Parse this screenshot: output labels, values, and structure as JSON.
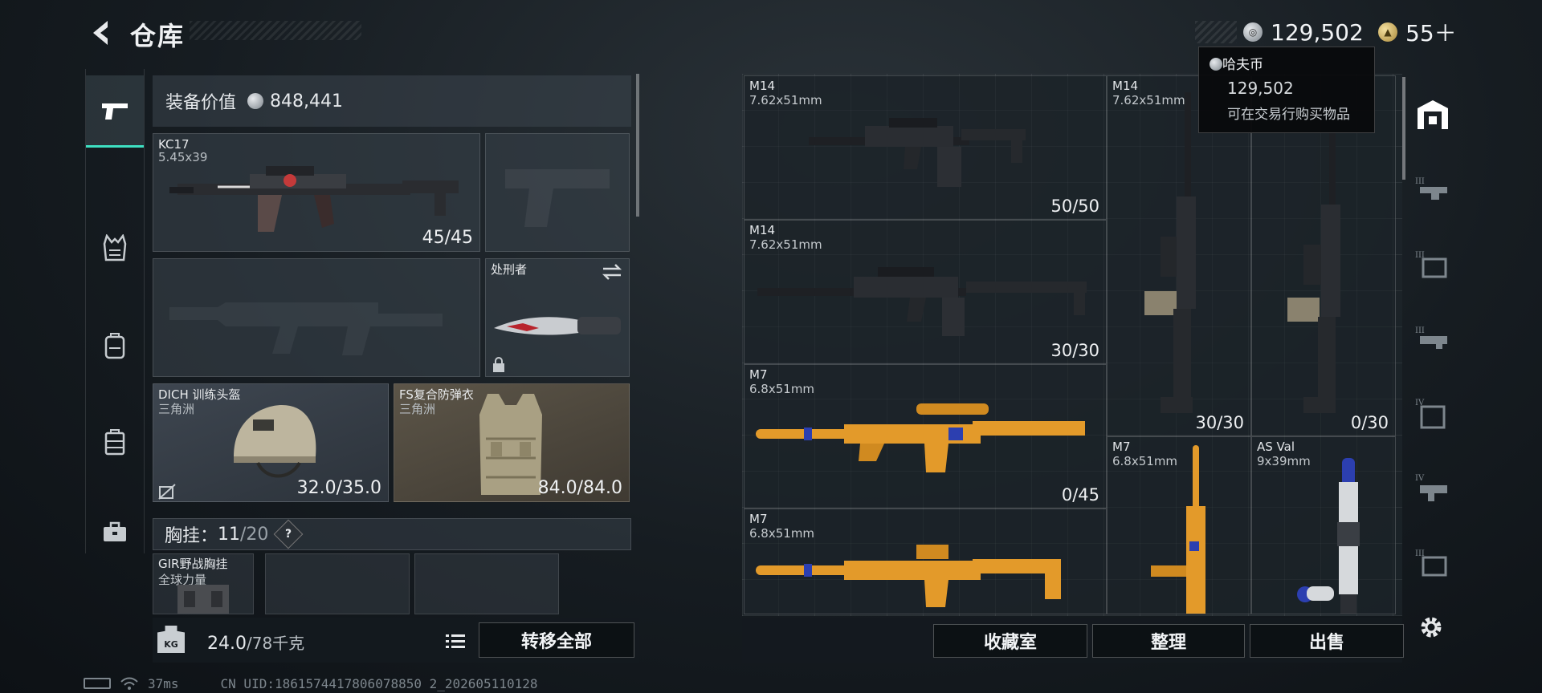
{
  "header": {
    "title": "仓库",
    "currency_hafu": "129,502",
    "currency_gold": "55＋"
  },
  "tooltip": {
    "title": "哈夫币",
    "amount": "129,502",
    "desc": "可在交易行购买物品"
  },
  "loadout": {
    "equip_value_label": "装备价值",
    "equip_value": "848,441",
    "primary": {
      "name": "KC17",
      "caliber": "5.45x39",
      "ammo": "45/45"
    },
    "knife": {
      "name": "处刑者"
    },
    "helmet": {
      "name": "DICH 训练头盔",
      "origin": "三角洲",
      "durability": "32.0/35.0"
    },
    "armor": {
      "name": "FS复合防弹衣",
      "origin": "三角洲",
      "durability": "84.0/84.0"
    },
    "chest": {
      "label": "胸挂：",
      "current": "11",
      "max": "/20",
      "help": "?"
    },
    "chest_item": {
      "name": "GIR野战胸挂",
      "origin": "全球力量"
    }
  },
  "weight": {
    "current": "24.0",
    "max": "/78千克",
    "icon_text": "KG"
  },
  "actions": {
    "transfer_all": "转移全部",
    "collection": "收藏室",
    "sort": "整理",
    "sell": "出售"
  },
  "storage": [
    {
      "name": "M14",
      "caliber": "7.62x51mm",
      "ammo": "50/50",
      "style": "black"
    },
    {
      "name": "M14",
      "caliber": "7.62x51mm",
      "ammo": "30/30",
      "style": "black"
    },
    {
      "name": "M7",
      "caliber": "6.8x51mm",
      "ammo": "0/45",
      "style": "orange"
    },
    {
      "name": "M7",
      "caliber": "6.8x51mm",
      "ammo": "",
      "style": "orange"
    },
    {
      "name": "M14",
      "caliber": "7.62x51mm",
      "ammo": "30/30",
      "style": "black"
    },
    {
      "name": "",
      "caliber": "",
      "ammo": "0/30",
      "style": "black"
    },
    {
      "name": "M7",
      "caliber": "6.8x51mm",
      "ammo": "",
      "style": "orange"
    },
    {
      "name": "AS Val",
      "caliber": "9x39mm",
      "ammo": "",
      "style": "silver"
    }
  ],
  "status": {
    "ping": "37ms",
    "uid": "CN UID:1861574417806078850 2_202605110128"
  },
  "colors": {
    "accent": "#3ee0c2",
    "orange_weapon": "#e39a2a",
    "panel": "#37404a"
  }
}
